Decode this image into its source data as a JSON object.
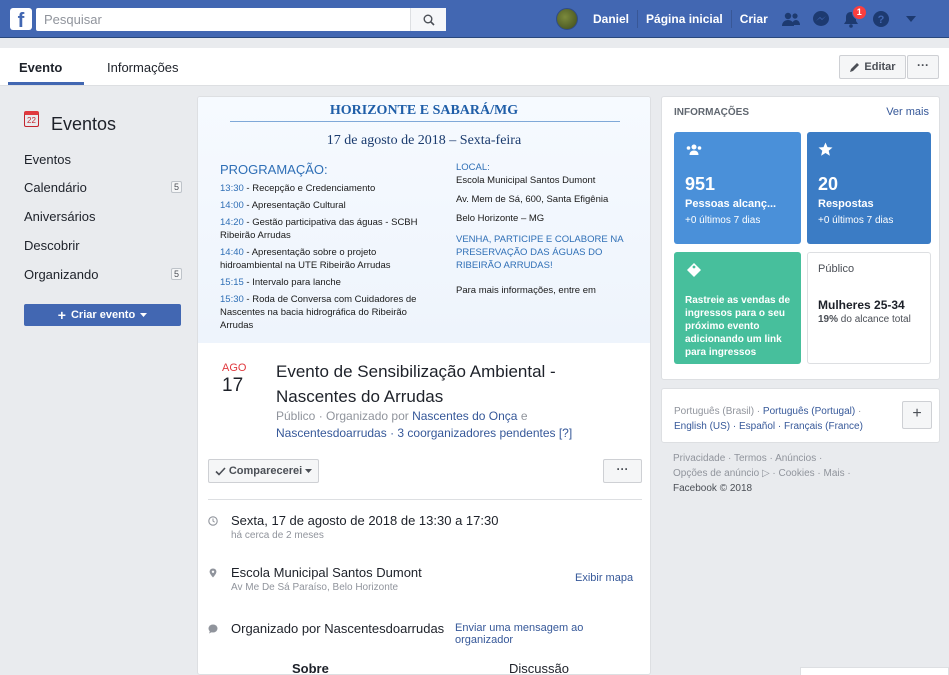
{
  "topbar": {
    "logo": "f",
    "search_placeholder": "Pesquisar",
    "user_name": "Daniel",
    "home_label": "Página inicial",
    "create_label": "Criar",
    "notifications_count": "1"
  },
  "tabs": {
    "event_label": "Evento",
    "info_label": "Informações",
    "edit_label": "Editar",
    "more_label": "···"
  },
  "leftnav": {
    "calendar_icon_text": "22",
    "title": "Eventos",
    "items": [
      {
        "label": "Eventos",
        "count": ""
      },
      {
        "label": "Calendário",
        "count": "5"
      },
      {
        "label": "Aniversários",
        "count": ""
      },
      {
        "label": "Descobrir",
        "count": ""
      },
      {
        "label": "Organizando",
        "count": "5"
      }
    ],
    "create_button": "Criar evento"
  },
  "cover": {
    "title": "HORIZONTE E SABARÁ/MG",
    "date": "17 de agosto de 2018 – Sexta-feira",
    "program_heading": "PROGRAMAÇÃO:",
    "program": [
      {
        "time": "13:30",
        "text": "- Recepção e Credenciamento"
      },
      {
        "time": "14:00",
        "text": "- Apresentação Cultural"
      },
      {
        "time": "14:20",
        "text": "- Gestão participativa das águas - SCBH Ribeirão Arrudas"
      },
      {
        "time": "14:40",
        "text": "- Apresentação sobre o projeto hidroambiental na UTE Ribeirão Arrudas"
      },
      {
        "time": "15:15",
        "text": "- Intervalo para lanche"
      },
      {
        "time": "15:30",
        "text": "- Roda de Conversa com Cuidadores de Nascentes na bacia hidrográfica do Ribeirão Arrudas"
      }
    ],
    "local_heading": "LOCAL:",
    "local_lines": [
      "Escola Municipal Santos Dumont",
      "Av. Mem de Sá, 600, Santa Efigênia",
      "Belo Horizonte – MG"
    ],
    "call_to_action": "VENHA, PARTICIPE E COLABORE NA PRESERVAÇÃO DAS ÁGUAS DO RIBEIRÃO ARRUDAS!",
    "more_info": "Para mais informações, entre em"
  },
  "event": {
    "month": "AGO",
    "day": "17",
    "title": "Evento de Sensibilização Ambiental - Nascentes do Arrudas",
    "sub_prefix": "Público · Organizado por ",
    "organizer": "Nascentes do Onça",
    "sub_and": " e ",
    "coorganizers": "Nascentesdoarrudas · 3 coorganizadores pendentes [?]",
    "attend_button": "Comparecerei",
    "more_button": "···",
    "datetime": "Sexta, 17 de agosto de 2018 de 13:30 a 17:30",
    "datetime_ago": "há cerca de 2 meses",
    "place": "Escola Municipal Santos Dumont",
    "address": "Av Me De Sá Paraíso, Belo Horizonte",
    "map_link": "Exibir mapa",
    "organized_by": "Organizado por Nascentesdoarrudas",
    "message_link": "Enviar uma mensagem ao organizador",
    "tab_about": "Sobre",
    "tab_discussion": "Discussão"
  },
  "insights": {
    "title": "INFORMAÇÕES",
    "see_more": "Ver mais",
    "reach_value": "951",
    "reach_label": "Pessoas alcanç...",
    "reach_sub": "+0 últimos 7 dias",
    "responses_value": "20",
    "responses_label": "Respostas",
    "responses_sub": "+0 últimos 7 dias",
    "tickets_text": "Rastreie as vendas de ingressos para o seu próximo evento adicionando um link para ingressos",
    "audience_label": "Público",
    "audience_main": "Mulheres 25-34",
    "audience_pct": "19%",
    "audience_rest": " do alcance total"
  },
  "languages": {
    "current": "Português (Brasil) · ",
    "options_line1": "Português (Portugal)",
    "sep": " · ",
    "options_line2": "English (US) · Español · Français (France)",
    "plus": "+"
  },
  "footer": {
    "line1": "Privacidade · Termos · Anúncios ·",
    "line2": "Opções de anúncio ▷ · Cookies · Mais ·",
    "line3": "Facebook © 2018"
  },
  "colors": {
    "brand": "#4267b2",
    "link": "#365899",
    "notification": "#fa3e3e",
    "tile_blue": "#4a90d9",
    "tile_green": "#47bf9c"
  }
}
